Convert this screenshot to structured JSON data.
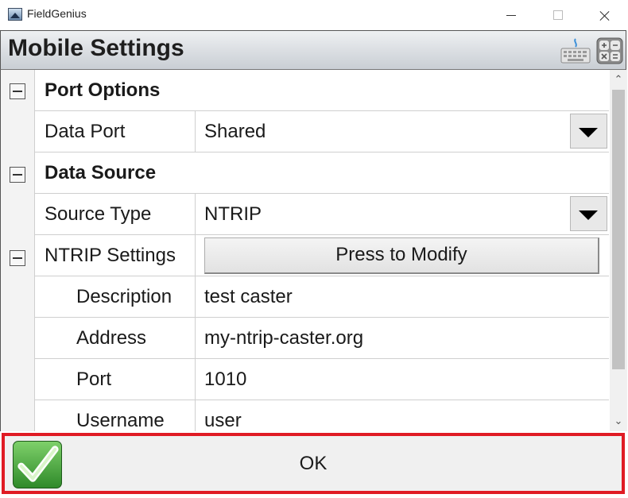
{
  "window": {
    "app_title": "FieldGenius"
  },
  "header": {
    "title": "Mobile Settings",
    "icons": [
      "keyboard-icon",
      "calculator-icon"
    ]
  },
  "sections": [
    {
      "title": "Port Options",
      "rows": [
        {
          "label": "Data Port",
          "value": "Shared",
          "control": "dropdown"
        }
      ]
    },
    {
      "title": "Data Source",
      "rows": [
        {
          "label": "Source Type",
          "value": "NTRIP",
          "control": "dropdown"
        },
        {
          "label": "NTRIP Settings",
          "button": "Press to Modify"
        },
        {
          "label": "Description",
          "value": "test caster"
        },
        {
          "label": "Address",
          "value": "my-ntrip-caster.org"
        },
        {
          "label": "Port",
          "value": "1010"
        },
        {
          "label": "Username",
          "value": "user"
        }
      ]
    }
  ],
  "footer": {
    "ok_label": "OK",
    "ok_icon": "checkmark-icon"
  },
  "colors": {
    "ok_border": "#e01b24",
    "header_bg": "#c9ced4",
    "check_green": "#3a9a32"
  }
}
